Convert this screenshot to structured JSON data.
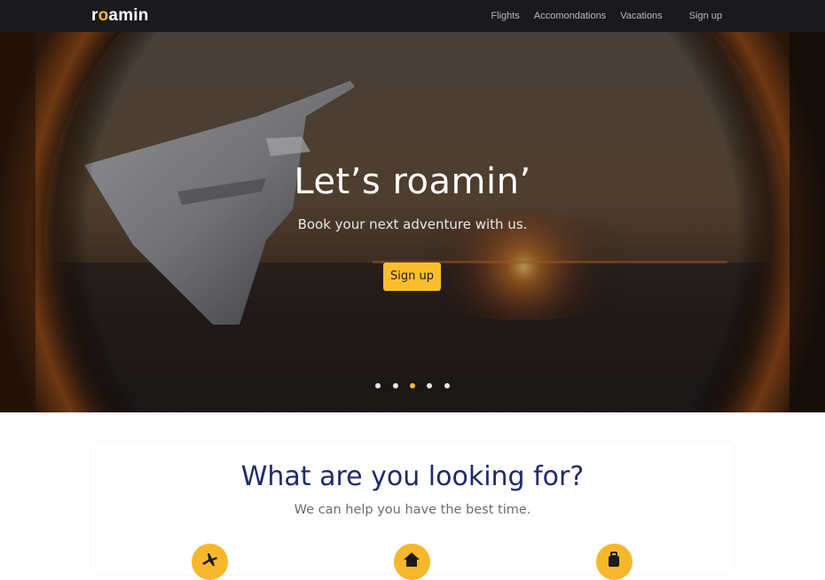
{
  "nav": {
    "logo": {
      "prefix": "r",
      "accent": "o",
      "suffix": "amin"
    },
    "links": [
      "Flights",
      "Accomondations",
      "Vacations"
    ],
    "signup_label": "Sign up"
  },
  "hero": {
    "title": "Let’s roamin’",
    "subtitle": "Book your next adventure with us.",
    "cta_label": "Sign up",
    "carousel": {
      "slides": 5,
      "active": 3
    }
  },
  "section": {
    "title": "What are you looking for?",
    "subtitle": "We can help you have the best time.",
    "categories": [
      {
        "icon": "airplane-icon"
      },
      {
        "icon": "house-icon"
      },
      {
        "icon": "luggage-icon"
      }
    ]
  },
  "colors": {
    "accent": "#f5b82a",
    "nav_bg": "#1a1a1e",
    "title_navy": "#1f2a6e"
  }
}
